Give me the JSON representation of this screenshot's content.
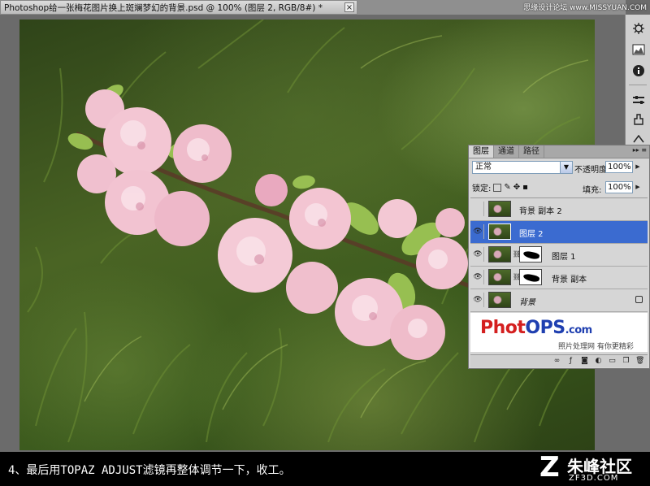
{
  "document": {
    "tab_title": "Photoshop给一张梅花图片换上斑斓梦幻的背景.psd @ 100% (图层 2, RGB/8#) *",
    "close_glyph": "×"
  },
  "watermark_top": "思缘设计论坛 www.MISSYUAN.COM",
  "layers_panel": {
    "tabs": [
      "图层",
      "通道",
      "路径"
    ],
    "menu_glyph": "▸▸ ≡",
    "blend_mode": "正常",
    "opacity_label": "不透明度:",
    "opacity_value": "100%",
    "lock_label": "锁定:",
    "fill_label": "填充:",
    "fill_value": "100%",
    "layers": [
      {
        "name": "背景 副本 2",
        "visible": false,
        "selected": false,
        "has_mask": false,
        "locked": false
      },
      {
        "name": "图层 2",
        "visible": true,
        "selected": true,
        "has_mask": false,
        "locked": false
      },
      {
        "name": "图层 1",
        "visible": true,
        "selected": false,
        "has_mask": true,
        "locked": false
      },
      {
        "name": "背景 副本",
        "visible": true,
        "selected": false,
        "has_mask": true,
        "locked": false
      },
      {
        "name": "背景",
        "visible": true,
        "selected": false,
        "has_mask": false,
        "locked": true
      }
    ],
    "logo": {
      "part1": "Phot",
      "part2": "OPS",
      "part3": ".com",
      "tagline": "照片处理网 有你更精彩"
    },
    "footer_buttons": [
      "link-icon",
      "fx-icon",
      "mask-icon",
      "adjustment-icon",
      "group-icon",
      "new-layer-icon",
      "trash-icon"
    ]
  },
  "caption": {
    "text": "4、最后用TOPAZ ADJUST滤镜再整体调节一下，收工。",
    "brand_name": "朱峰社区",
    "brand_url": "ZF3D.COM",
    "brand_mark": "Z"
  },
  "colors": {
    "selected_layer": "#3b6bd0",
    "logo_red": "#d41f1f",
    "logo_blue": "#1f3fb0"
  }
}
